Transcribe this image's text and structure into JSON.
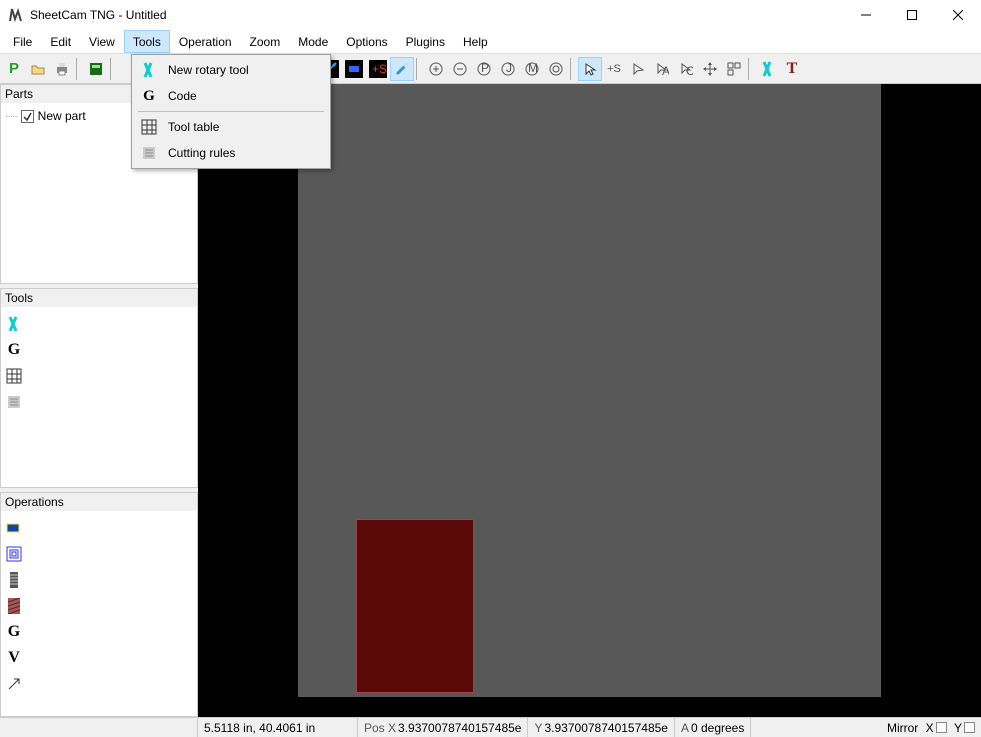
{
  "window": {
    "title": "SheetCam TNG - Untitled"
  },
  "menu": {
    "file": "File",
    "edit": "Edit",
    "view": "View",
    "tools": "Tools",
    "operation": "Operation",
    "zoom": "Zoom",
    "mode": "Mode",
    "options": "Options",
    "plugins": "Plugins",
    "help": "Help"
  },
  "tools_menu": {
    "new_rotary_tool": "New rotary tool",
    "code": "Code",
    "tool_table": "Tool table",
    "cutting_rules": "Cutting rules"
  },
  "panels": {
    "parts": "Parts",
    "tools": "Tools",
    "operations": "Operations"
  },
  "parts_tree": {
    "new_part": "New part"
  },
  "statusbar": {
    "dim": "5.5118 in, 40.4061 in",
    "posx_label": "Pos X",
    "posx": "3.9370078740157485e",
    "posy_label": "Y",
    "posy": "3.9370078740157485e",
    "angle_label": "A",
    "angle": "0 degrees",
    "mirror_label": "Mirror",
    "mirror_x": "X",
    "mirror_y": "Y"
  }
}
